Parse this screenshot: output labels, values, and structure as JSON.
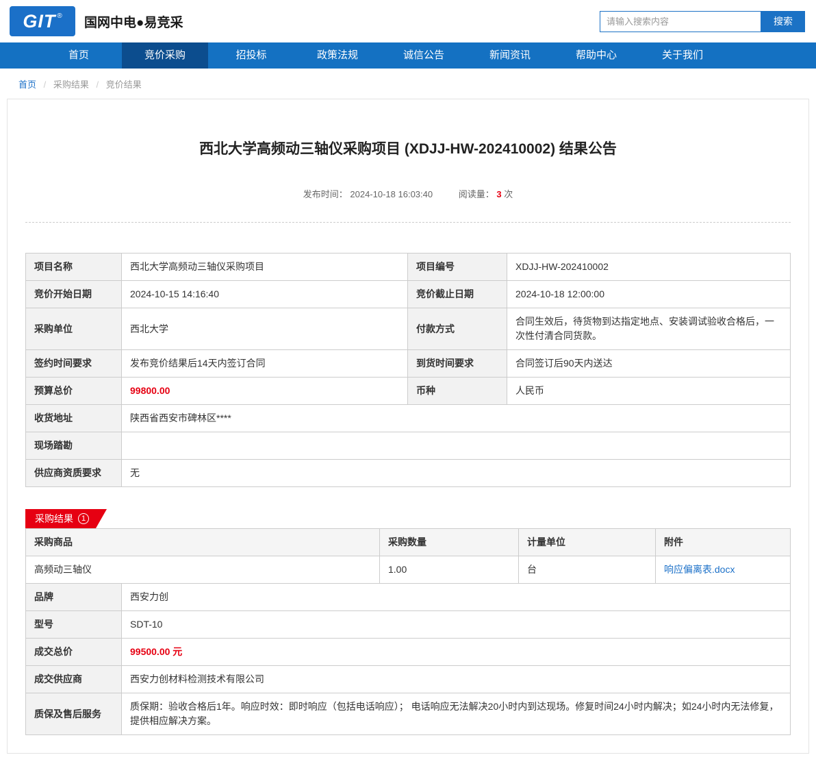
{
  "header": {
    "logo_text": "GIT",
    "logo_reg": "®",
    "site_title": "国网中电●易竞采",
    "search": {
      "placeholder": "请输入搜索内容",
      "button": "搜索"
    }
  },
  "nav": {
    "items": [
      {
        "label": "首页"
      },
      {
        "label": "竞价采购"
      },
      {
        "label": "招投标"
      },
      {
        "label": "政策法规"
      },
      {
        "label": "诚信公告"
      },
      {
        "label": "新闻资讯"
      },
      {
        "label": "帮助中心"
      },
      {
        "label": "关于我们"
      }
    ]
  },
  "breadcrumb": {
    "items": [
      "首页",
      "采购结果",
      "竞价结果"
    ],
    "separator": "/"
  },
  "announcement": {
    "title": "西北大学高频动三轴仪采购项目 (XDJJ-HW-202410002) 结果公告",
    "publish_label": "发布时间：",
    "publish_time": "2024-10-18 16:03:40",
    "views_label": "阅读量：",
    "views_count": "3",
    "views_unit": "次"
  },
  "info_table": {
    "rows": [
      {
        "label1": "项目名称",
        "value1": "西北大学高频动三轴仪采购项目",
        "label2": "项目编号",
        "value2": "XDJJ-HW-202410002"
      },
      {
        "label1": "竞价开始日期",
        "value1": "2024-10-15 14:16:40",
        "label2": "竞价截止日期",
        "value2": "2024-10-18 12:00:00"
      },
      {
        "label1": "采购单位",
        "value1": "西北大学",
        "label2": "付款方式",
        "value2": "合同生效后，待货物到达指定地点、安装调试验收合格后，一次性付清合同货款。"
      },
      {
        "label1": "签约时间要求",
        "value1": "发布竞价结果后14天内签订合同",
        "label2": "到货时间要求",
        "value2": "合同签订后90天内送达"
      },
      {
        "label1": "预算总价",
        "value1": "99800.00",
        "label2": "币种",
        "value2": "人民币"
      },
      {
        "label1": "收货地址",
        "value1": "陕西省西安市碑林区****"
      },
      {
        "label1": "现场踏勘",
        "value1": ""
      },
      {
        "label1": "供应商资质要求",
        "value1": "无"
      }
    ]
  },
  "result_section": {
    "badge_label": "采购结果",
    "badge_number": "1",
    "product_table": {
      "headers": [
        "采购商品",
        "采购数量",
        "计量单位",
        "附件"
      ],
      "row": {
        "name": "高频动三轴仪",
        "quantity": "1.00",
        "unit": "台",
        "attachment": "响应偏离表.docx"
      }
    },
    "detail_rows": [
      {
        "label": "品牌",
        "value": "西安力创"
      },
      {
        "label": "型号",
        "value": "SDT-10"
      },
      {
        "label": "成交总价",
        "value": "99500.00 元"
      },
      {
        "label": "成交供应商",
        "value": "西安力创材料检测技术有限公司"
      },
      {
        "label": "质保及售后服务",
        "value": "质保期：验收合格后1年。响应时效：即时响应（包括电话响应）； 电话响应无法解决20小时内到达现场。修复时间24小时内解决；如24小时内无法修复，提供相应解决方案。"
      }
    ]
  }
}
